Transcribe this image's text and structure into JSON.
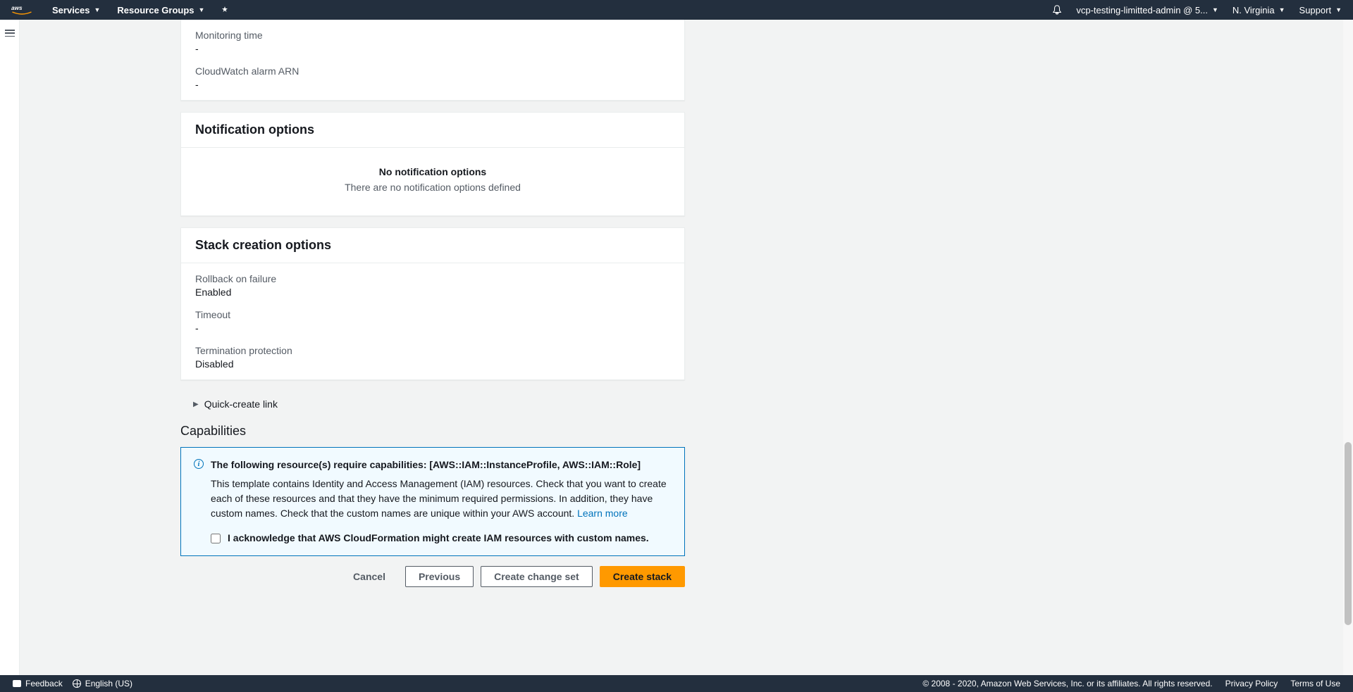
{
  "nav": {
    "services": "Services",
    "resource_groups": "Resource Groups",
    "account": "vcp-testing-limitted-admin @ 5...",
    "region": "N. Virginia",
    "support": "Support"
  },
  "monitoring": {
    "monitoring_time_label": "Monitoring time",
    "monitoring_time_value": "-",
    "cloudwatch_arn_label": "CloudWatch alarm ARN",
    "cloudwatch_arn_value": "-"
  },
  "notification": {
    "title": "Notification options",
    "empty_title": "No notification options",
    "empty_desc": "There are no notification options defined"
  },
  "stack_creation": {
    "title": "Stack creation options",
    "rollback_label": "Rollback on failure",
    "rollback_value": "Enabled",
    "timeout_label": "Timeout",
    "timeout_value": "-",
    "termination_label": "Termination protection",
    "termination_value": "Disabled"
  },
  "quick_create": "Quick-create link",
  "capabilities": {
    "heading": "Capabilities",
    "info_title": "The following resource(s) require capabilities: [AWS::IAM::InstanceProfile, AWS::IAM::Role]",
    "info_text": "This template contains Identity and Access Management (IAM) resources. Check that you want to create each of these resources and that they have the minimum required permissions. In addition, they have custom names. Check that the custom names are unique within your AWS account. ",
    "learn_more": "Learn more",
    "ack_label": "I acknowledge that AWS CloudFormation might create IAM resources with custom names."
  },
  "buttons": {
    "cancel": "Cancel",
    "previous": "Previous",
    "create_change_set": "Create change set",
    "create_stack": "Create stack"
  },
  "bottom": {
    "feedback": "Feedback",
    "language": "English (US)",
    "copyright": "© 2008 - 2020, Amazon Web Services, Inc. or its affiliates. All rights reserved.",
    "privacy": "Privacy Policy",
    "terms": "Terms of Use"
  }
}
